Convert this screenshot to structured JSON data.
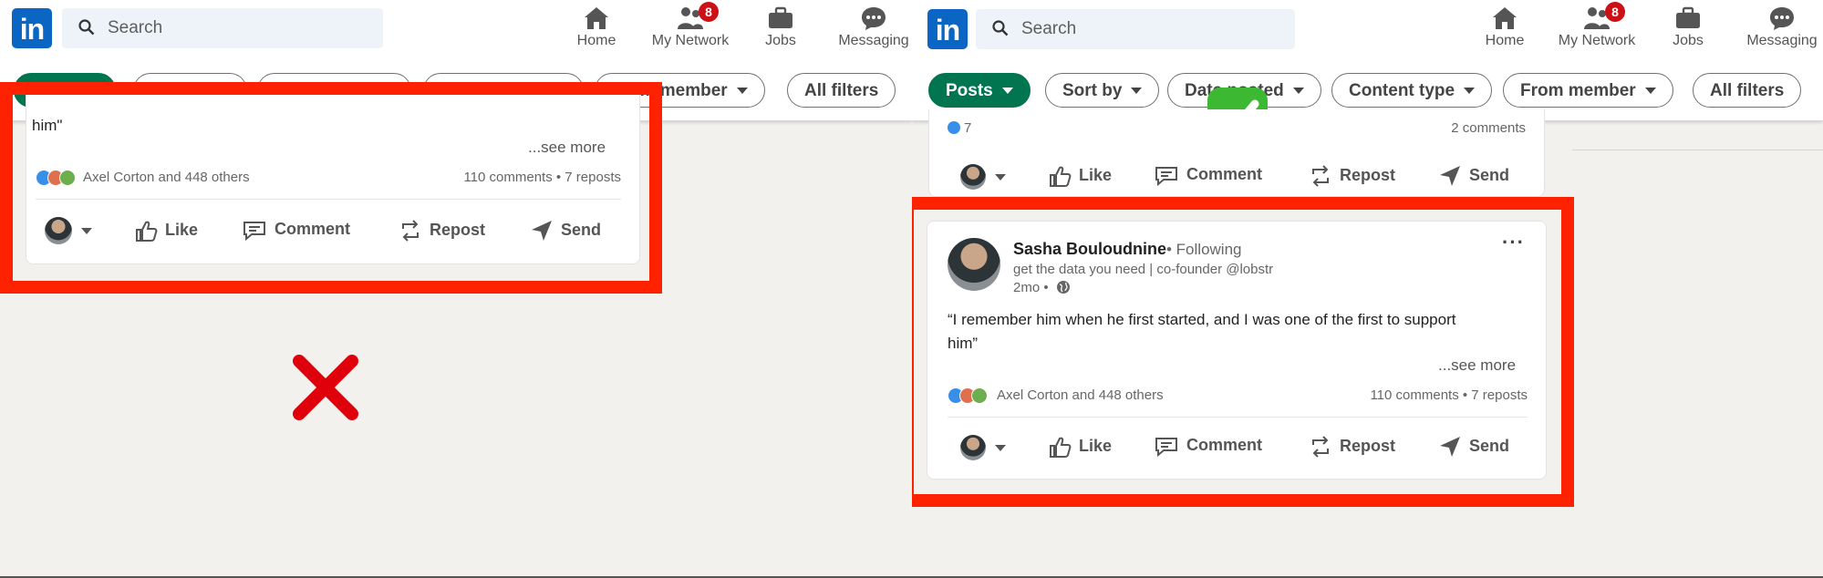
{
  "nav": {
    "search_placeholder": "Search",
    "home": "Home",
    "my_network": "My Network",
    "network_badge": "8",
    "jobs": "Jobs",
    "messaging": "Messaging"
  },
  "filters": {
    "posts": "Posts",
    "sort_by": "Sort by",
    "date_posted": "Date posted",
    "content_type": "Content type",
    "from_member": "From member",
    "all_filters": "All filters"
  },
  "left_card": {
    "body_tail": "him\"",
    "see_more": "...see more",
    "reactions": "Axel Corton and 448 others",
    "stats": "110 comments • 7 reposts"
  },
  "right_prev_card": {
    "reaction_count": "7",
    "comments": "2 comments"
  },
  "right_card": {
    "author": "Sasha Bouloudnine",
    "following": "• Following",
    "headline": "get the data you need | co-founder @lobstr",
    "age": "2mo •",
    "body_line1": "“I remember him when he first started, and I was one of the first to support",
    "body_line2": "him”",
    "see_more": "...see more",
    "reactions": "Axel Corton and 448 others",
    "stats": "110 comments • 7 reposts"
  },
  "actions": {
    "like": "Like",
    "comment": "Comment",
    "repost": "Repost",
    "send": "Send"
  },
  "markers": {
    "wrong": "✕",
    "right": "✓"
  },
  "colors": {
    "linkedin_blue": "#0a66c2",
    "active_chip": "#01754f",
    "highlight_red": "#ff2200",
    "check_green": "#3cb832",
    "cross_red": "#e0000b"
  }
}
